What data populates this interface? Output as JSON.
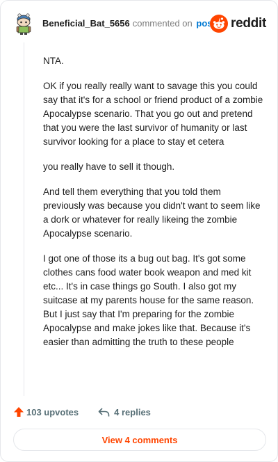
{
  "header": {
    "author": "Beneficial_Bat_5656",
    "commented_on": "commented on",
    "post_link": "post",
    "brand": "reddit"
  },
  "comment": {
    "paragraphs": [
      "NTA.",
      "OK if you really really want to savage this you could say that it's for a school or friend product of a zombie Apocalypse scenario. That you go out and pretend that you were the last survivor of humanity or last survivor looking for a place to stay et cetera",
      "you really have to sell it though.",
      "And tell them everything that you told them previously was because you didn't want to seem like a dork or whatever for really likeing the zombie Apocalypse scenario.",
      "I got one of those its a bug out bag. It's got some clothes cans food water book weapon and med kit etc... It's in case things go South. I also got my suitcase at my parents house for the same reason. But I just say that I'm preparing for the zombie Apocalypse and make jokes like that. Because it's easier than admitting the truth to these people"
    ]
  },
  "footer": {
    "upvotes": "103 upvotes",
    "replies": "4 replies",
    "view_comments": "View 4 comments"
  },
  "icons": {
    "avatar": "snoo-avatar-icon",
    "logo": "reddit-logo-icon",
    "upvote": "upvote-arrow-icon",
    "reply": "reply-arrow-icon"
  },
  "colors": {
    "brand": "#ff4500",
    "link": "#0079d3",
    "muted": "#576f76"
  }
}
